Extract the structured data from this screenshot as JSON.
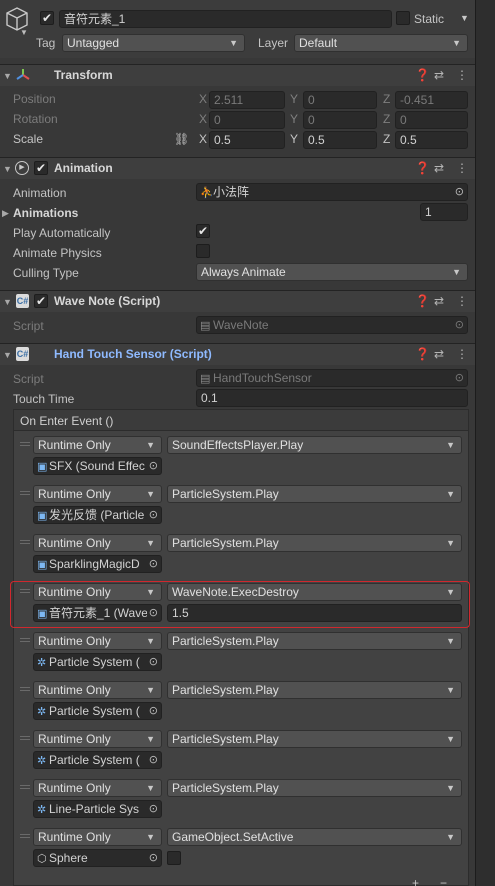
{
  "object": {
    "active_checked": true,
    "name": "音符元素_1",
    "static_label": "Static",
    "tag_label": "Tag",
    "tag_value": "Untagged",
    "layer_label": "Layer",
    "layer_value": "Default"
  },
  "transform": {
    "title": "Transform",
    "position_label": "Position",
    "rotation_label": "Rotation",
    "scale_label": "Scale",
    "axes": [
      "X",
      "Y",
      "Z"
    ],
    "position": [
      "2.511",
      "0",
      "-0.451"
    ],
    "rotation": [
      "0",
      "0",
      "0"
    ],
    "scale": [
      "0.5",
      "0.5",
      "0.5"
    ]
  },
  "animation": {
    "title": "Animation",
    "animation_label": "Animation",
    "animation_value": "小法阵",
    "animations_label": "Animations",
    "animations_count": "1",
    "play_auto_label": "Play Automatically",
    "play_auto_checked": true,
    "animate_physics_label": "Animate Physics",
    "animate_physics_checked": false,
    "culling_label": "Culling Type",
    "culling_value": "Always Animate"
  },
  "wave_note": {
    "title": "Wave Note (Script)",
    "script_label": "Script",
    "script_value": "WaveNote"
  },
  "hand_touch": {
    "title": "Hand Touch Sensor (Script)",
    "script_label": "Script",
    "script_value": "HandTouchSensor",
    "touch_time_label": "Touch Time",
    "touch_time_value": "0.1",
    "event_header": "On Enter Event ()",
    "events": [
      {
        "mode": "Runtime Only",
        "function": "SoundEffectsPlayer.Play",
        "target": "SFX (Sound Effec",
        "target_icon": "script-object-icon",
        "arg": ""
      },
      {
        "mode": "Runtime Only",
        "function": "ParticleSystem.Play",
        "target": "发光反馈 (Particle",
        "target_icon": "script-object-icon",
        "arg": ""
      },
      {
        "mode": "Runtime Only",
        "function": "ParticleSystem.Play",
        "target": "SparklingMagicD",
        "target_icon": "script-object-icon",
        "arg": ""
      },
      {
        "mode": "Runtime Only",
        "function": "WaveNote.ExecDestroy",
        "target": "音符元素_1 (Wave",
        "target_icon": "script-object-icon",
        "arg": "1.5"
      },
      {
        "mode": "Runtime Only",
        "function": "ParticleSystem.Play",
        "target": "Particle System (",
        "target_icon": "particle-icon",
        "arg": ""
      },
      {
        "mode": "Runtime Only",
        "function": "ParticleSystem.Play",
        "target": "Particle System (",
        "target_icon": "particle-icon",
        "arg": ""
      },
      {
        "mode": "Runtime Only",
        "function": "ParticleSystem.Play",
        "target": "Particle System (",
        "target_icon": "particle-icon",
        "arg": ""
      },
      {
        "mode": "Runtime Only",
        "function": "ParticleSystem.Play",
        "target": "Line-Particle Sys",
        "target_icon": "particle-icon",
        "arg": ""
      },
      {
        "mode": "Runtime Only",
        "function": "GameObject.SetActive",
        "target": "Sphere",
        "target_icon": "gameobject-icon",
        "arg": ""
      }
    ]
  },
  "colors": {
    "highlight": "#d0282e",
    "link_blue": "#8fbaff"
  }
}
